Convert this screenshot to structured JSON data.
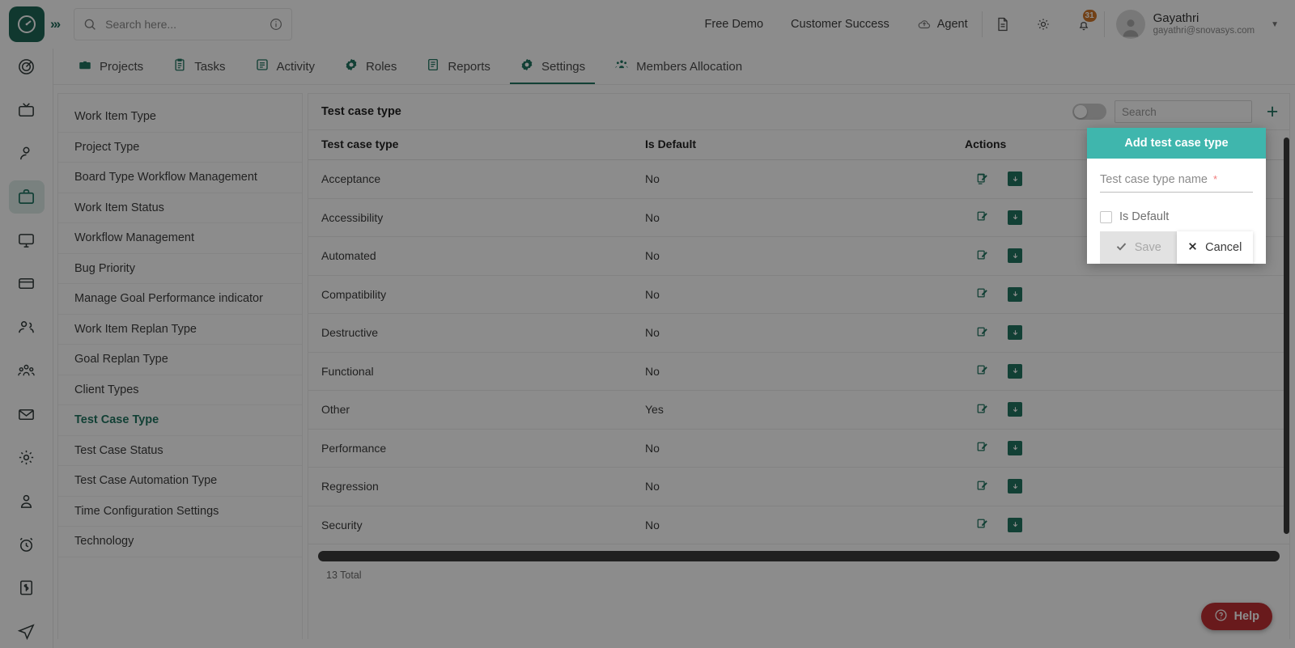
{
  "header": {
    "logo_icon": "clock-logo-icon",
    "expand_icon": "chevrons-right-icon",
    "search_placeholder": "Search here...",
    "search_value": "",
    "search_icon": "search-icon",
    "info_icon": "info-circle-icon",
    "links": [
      {
        "label": "Free Demo",
        "icon": null
      },
      {
        "label": "Customer Success",
        "icon": null
      },
      {
        "label": "Agent",
        "icon": "cloud-upload-icon"
      }
    ],
    "icon_buttons": [
      {
        "name": "document-icon"
      },
      {
        "name": "gear-icon"
      },
      {
        "name": "bell-icon",
        "badge": "31"
      }
    ],
    "profile": {
      "name": "Gayathri",
      "email": "gayathri@snovasys.com",
      "avatar_icon": "user-avatar-icon",
      "caret_icon": "chevron-down-icon"
    }
  },
  "tabs": [
    {
      "label": "Projects",
      "icon": "briefcase-icon",
      "active": false
    },
    {
      "label": "Tasks",
      "icon": "clipboard-icon",
      "active": false
    },
    {
      "label": "Activity",
      "icon": "list-box-icon",
      "active": false
    },
    {
      "label": "Roles",
      "icon": "gear-badge-icon",
      "active": false
    },
    {
      "label": "Reports",
      "icon": "report-icon",
      "active": false
    },
    {
      "label": "Settings",
      "icon": "gear-icon",
      "active": true
    },
    {
      "label": "Members Allocation",
      "icon": "people-icon",
      "active": false
    }
  ],
  "rail": [
    {
      "name": "target-icon",
      "active": false
    },
    {
      "name": "tv-icon",
      "active": false
    },
    {
      "name": "person-icon",
      "active": false
    },
    {
      "name": "briefcase-icon",
      "active": true
    },
    {
      "name": "monitor-icon",
      "active": false
    },
    {
      "name": "card-icon",
      "active": false
    },
    {
      "name": "users-icon",
      "active": false
    },
    {
      "name": "group-icon",
      "active": false
    },
    {
      "name": "mail-icon",
      "active": false
    },
    {
      "name": "gear-icon",
      "active": false
    },
    {
      "name": "user-badge-icon",
      "active": false
    },
    {
      "name": "alarm-clock-icon",
      "active": false
    },
    {
      "name": "invoice-icon",
      "active": false
    },
    {
      "name": "send-icon",
      "active": false
    }
  ],
  "submenu": [
    {
      "label": "Work Item Type",
      "active": false
    },
    {
      "label": "Project Type",
      "active": false
    },
    {
      "label": "Board Type Workflow Management",
      "active": false
    },
    {
      "label": "Work Item Status",
      "active": false
    },
    {
      "label": "Workflow Management",
      "active": false
    },
    {
      "label": "Bug Priority",
      "active": false
    },
    {
      "label": "Manage Goal Performance indicator",
      "active": false
    },
    {
      "label": "Work Item Replan Type",
      "active": false
    },
    {
      "label": "Goal Replan Type",
      "active": false
    },
    {
      "label": "Client Types",
      "active": false
    },
    {
      "label": "Test Case Type",
      "active": true
    },
    {
      "label": "Test Case Status",
      "active": false
    },
    {
      "label": "Test Case Automation Type",
      "active": false
    },
    {
      "label": "Time Configuration Settings",
      "active": false
    },
    {
      "label": "Technology",
      "active": false
    }
  ],
  "panel": {
    "title": "Test case type",
    "toggle_state": "off",
    "search_placeholder": "Search",
    "search_value": "",
    "add_icon": "plus-icon",
    "columns": [
      "Test case type",
      "Is Default",
      "Actions"
    ],
    "rows": [
      {
        "name": "Acceptance",
        "is_default": "No"
      },
      {
        "name": "Accessibility",
        "is_default": "No"
      },
      {
        "name": "Automated",
        "is_default": "No"
      },
      {
        "name": "Compatibility",
        "is_default": "No"
      },
      {
        "name": "Destructive",
        "is_default": "No"
      },
      {
        "name": "Functional",
        "is_default": "No"
      },
      {
        "name": "Other",
        "is_default": "Yes"
      },
      {
        "name": "Performance",
        "is_default": "No"
      },
      {
        "name": "Regression",
        "is_default": "No"
      },
      {
        "name": "Security",
        "is_default": "No"
      }
    ],
    "row_action_icons": [
      "edit-icon",
      "download-box-icon"
    ],
    "total": "13 Total"
  },
  "modal": {
    "title": "Add test case type",
    "name_label": "Test case type name",
    "name_value": "",
    "required_mark": "*",
    "checkbox_label": "Is Default",
    "checkbox_checked": false,
    "save_label": "Save",
    "save_icon": "check-icon",
    "cancel_label": "Cancel",
    "cancel_icon": "x-icon"
  },
  "help": {
    "label": "Help",
    "icon": "question-circle-icon"
  },
  "colors": {
    "brand_green": "#0b7a60",
    "logo_green": "#0b6b56",
    "modal_teal": "#3fb6ad",
    "badge_orange": "#e8720c",
    "help_red": "#e5252a"
  }
}
